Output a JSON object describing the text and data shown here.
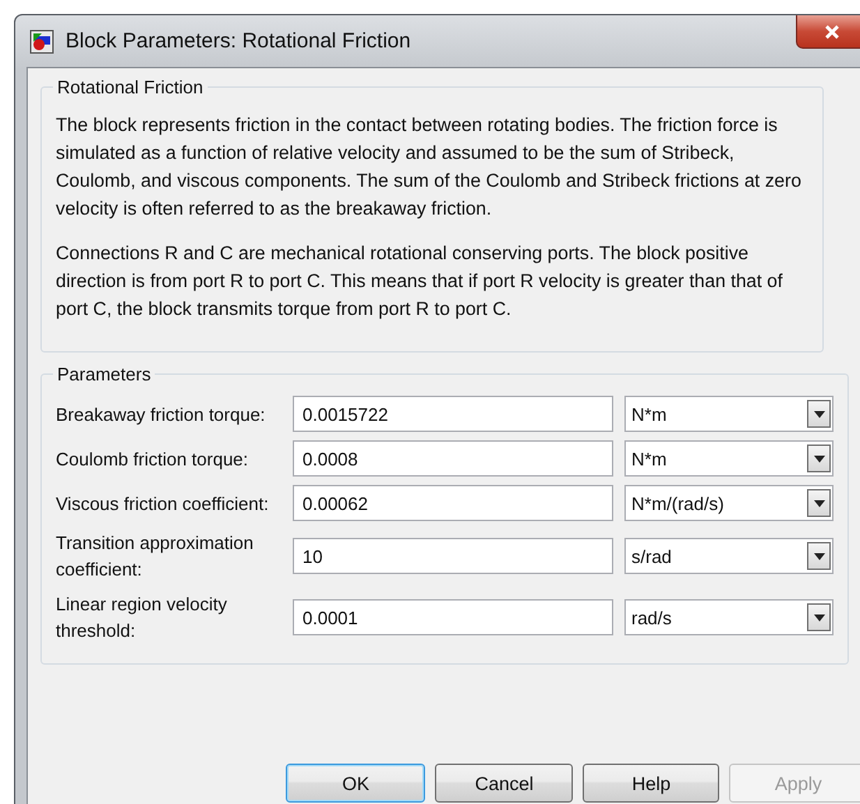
{
  "window": {
    "title": "Block Parameters: Rotational Friction"
  },
  "description": {
    "title": "Rotational Friction",
    "paragraphs": [
      "The block represents friction in the contact between rotating bodies. The friction force is simulated as a function of relative velocity and assumed to be the sum of Stribeck, Coulomb, and viscous components. The sum of the Coulomb and Stribeck frictions at zero velocity is often referred to as the breakaway friction.",
      "Connections R and C are mechanical rotational conserving ports. The block positive direction is from port R to port C. This means that if port R velocity is greater than that of port C, the block transmits torque from port R to port C."
    ]
  },
  "parameters": {
    "title": "Parameters",
    "rows": [
      {
        "label": "Breakaway friction torque:",
        "value": "0.0015722",
        "unit": "N*m"
      },
      {
        "label": "Coulomb friction torque:",
        "value": "0.0008",
        "unit": "N*m"
      },
      {
        "label": "Viscous friction coefficient:",
        "value": "0.00062",
        "unit": "N*m/(rad/s)"
      },
      {
        "label": "Transition approximation coefficient:",
        "value": "10",
        "unit": "s/rad"
      },
      {
        "label": "Linear region velocity threshold:",
        "value": "0.0001",
        "unit": "rad/s"
      }
    ]
  },
  "buttons": [
    {
      "label": "OK",
      "default": true,
      "disabled": false
    },
    {
      "label": "Cancel",
      "default": false,
      "disabled": false
    },
    {
      "label": "Help",
      "default": false,
      "disabled": false
    },
    {
      "label": "Apply",
      "default": false,
      "disabled": true
    }
  ]
}
